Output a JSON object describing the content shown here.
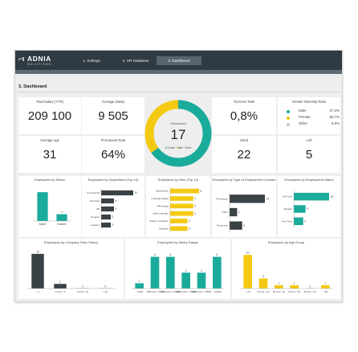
{
  "brand": {
    "mark": "⌐ı",
    "name": "ADNIA",
    "subtitle": "SOLUTIONS"
  },
  "tabs": [
    {
      "label": "1. Settings",
      "active": false
    },
    {
      "label": "2. HR Database",
      "active": false
    },
    {
      "label": "3. Dashboard",
      "active": true
    }
  ],
  "page_title": "3. Dashboard",
  "colors": {
    "teal": "#1aab9b",
    "dark": "#3a4246",
    "yellow": "#f4c911",
    "gray": "#c9c9c9",
    "topbar": "#2f3a42"
  },
  "kpis": {
    "total_salary": {
      "title": "Total Salary (YTD)",
      "value": "209 100"
    },
    "average_salary": {
      "title": "Average Salary",
      "value": "9 505"
    },
    "average_age": {
      "title": "Average Age",
      "value": "31"
    },
    "permanent_rate": {
      "title": "Permanent Rate",
      "value": "64%"
    },
    "turnover_rate": {
      "title": "Turnover Rate",
      "value": "0,8%"
    },
    "hired": {
      "title": "Hired",
      "value": "22"
    },
    "left": {
      "title": "Left",
      "value": "5"
    }
  },
  "headcount": {
    "label": "Headcount",
    "value": "17",
    "legend": [
      "Female",
      "Male",
      "Other"
    ],
    "shares": [
      0.65,
      0.35
    ]
  },
  "gender_ratio": {
    "title": "Gender Diversity Ratio",
    "items": [
      {
        "name": "Male",
        "value": "27,3%",
        "color": "#1aab9b"
      },
      {
        "name": "Female",
        "value": "66,7%",
        "color": "#f4c911"
      },
      {
        "name": "Other",
        "value": "6,0%",
        "color": "#c9c9c9"
      }
    ]
  },
  "chart_data": [
    {
      "type": "bar",
      "orientation": "vertical",
      "title": "Employees by Status",
      "categories": [
        "Active",
        "Inactive"
      ],
      "values": [
        17,
        4
      ],
      "labels": [
        "",
        "4"
      ],
      "colors": [
        "#1aab9b",
        "#1aab9b"
      ],
      "ymax": 18
    },
    {
      "type": "bar",
      "orientation": "horizontal",
      "title": "Employees by Department (Top 10)",
      "categories": [
        "Commercial",
        "Financial",
        "HR",
        "Projects",
        "Logistics"
      ],
      "values": [
        10,
        4,
        4,
        3,
        3
      ],
      "labels": [
        "10",
        "4",
        "4",
        "3",
        "3"
      ],
      "colors": [
        "#3a4246",
        "#3a4246",
        "#3a4246",
        "#3a4246",
        "#3a4246"
      ],
      "xmax": 10
    },
    {
      "type": "bar",
      "orientation": "horizontal",
      "title": "Employees by Role (Top 10)",
      "categories": [
        "Salesperson",
        "Financial analyst",
        "HR Analyst",
        "Sales manager",
        "Supply coordinator",
        "Engineer"
      ],
      "values": [
        5,
        4,
        4,
        4,
        3,
        3
      ],
      "labels": [
        "5",
        "4",
        "4",
        "4",
        "3",
        "3"
      ],
      "colors": [
        "#f4c911",
        "#f4c911",
        "#f4c911",
        "#f4c911",
        "#f4c911",
        "#f4c911"
      ],
      "xmax": 5
    },
    {
      "type": "bar",
      "orientation": "horizontal",
      "title": "Employees by Type of Employment Contract",
      "categories": [
        "Permanent",
        "Other",
        "Temporary"
      ],
      "values": [
        14,
        3,
        5
      ],
      "labels": [
        "14",
        "3",
        "5"
      ],
      "colors": [
        "#3a4246",
        "#3a4246",
        "#3a4246"
      ],
      "xmax": 14
    },
    {
      "type": "bar",
      "orientation": "horizontal",
      "title": "Employees by Employment Status",
      "categories": [
        "Full Time",
        "Student",
        "Part Time"
      ],
      "values": [
        15,
        5,
        4
      ],
      "labels": [
        "15",
        "5",
        "4"
      ],
      "colors": [
        "#1aab9b",
        "#1aab9b",
        "#1aab9b"
      ],
      "xmax": 15
    },
    {
      "type": "bar",
      "orientation": "vertical",
      "title": "Employees by Company Time (Years)",
      "categories": [
        "< 2",
        "2 and < 5",
        "5 and < 10",
        "> 10"
      ],
      "values": [
        15,
        2,
        0,
        0
      ],
      "labels": [
        "15",
        "2",
        "0",
        "0"
      ],
      "colors": [
        "#3a4246",
        "#3a4246",
        "#3a4246",
        "#3a4246"
      ],
      "ymax": 16
    },
    {
      "type": "bar",
      "orientation": "vertical",
      "title": "Employees by Salary Range",
      "categories": [
        "< 2000",
        "2000 and < 5000",
        "5000 and < 10000",
        "10000 and < 15000",
        "15000 and < 20000",
        "> 20000"
      ],
      "values": [
        1,
        6,
        6,
        3,
        3,
        6
      ],
      "labels": [
        "1",
        "6",
        "6",
        "3",
        "3",
        "6"
      ],
      "colors": [
        "#1aab9b",
        "#1aab9b",
        "#1aab9b",
        "#1aab9b",
        "#1aab9b",
        "#1aab9b"
      ],
      "ymax": 7
    },
    {
      "type": "bar",
      "orientation": "vertical",
      "title": "Employees by Age Group",
      "categories": [
        "< 20",
        "20 and < 30",
        "30 and < 40",
        "40 and < 50",
        "50 and < 60",
        "> 60"
      ],
      "values": [
        10,
        3,
        1,
        1,
        0,
        1
      ],
      "labels": [
        "10",
        "3",
        "1",
        "1",
        "0",
        "1"
      ],
      "colors": [
        "#f4c911",
        "#f4c911",
        "#f4c911",
        "#f4c911",
        "#f4c911",
        "#f4c911"
      ],
      "ymax": 11
    }
  ]
}
